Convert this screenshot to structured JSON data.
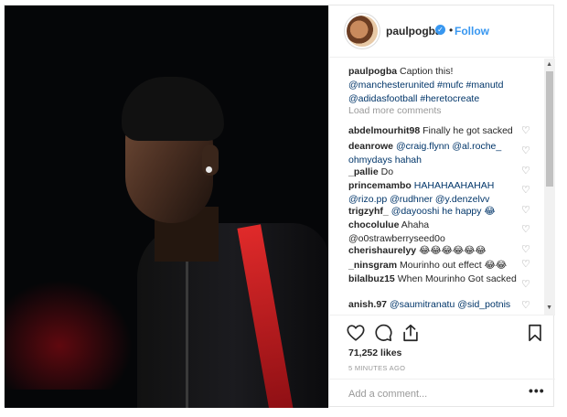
{
  "post": {
    "username": "paulpogba",
    "follow_label": "Follow",
    "dot": "•",
    "verified_glyph": "✓",
    "caption": {
      "username": "paulpogba",
      "line1_text": "Caption this!",
      "line2_tags": "@manchesterunited #mufc #manutd",
      "line3_tags": "@adidasfootball #heretocreate"
    },
    "load_more": "Load more comments",
    "comments": [
      {
        "user": "abdelmourhit98",
        "text": "Finally he got sacked"
      },
      {
        "user": "deanrowe",
        "text": "@craig.flynn @al.roche_ ohmydays hahah"
      },
      {
        "user": "_pallie",
        "text": "Do"
      },
      {
        "user": "princemambo",
        "text": "HAHAHAAHAHAH @rizo.pp @rudhner @y.denzelvv"
      },
      {
        "user": "trigzyhf_",
        "text": "@dayooshi he happy 😂"
      },
      {
        "user": "chocolulue",
        "text": "Ahaha @o0strawberryseed0o"
      },
      {
        "user": "cherishaurelyy",
        "text": "😂😂😂😂😂😂"
      },
      {
        "user": "_ninsgram",
        "text": "Mourinho out effect 😂😂"
      },
      {
        "user": "bilalbuz15",
        "text": "When Mourinho Got sacked"
      },
      {
        "user": "anish.97",
        "text": "@saumitranatu @sid_potnis"
      }
    ],
    "likes": "71,252 likes",
    "time": "5 MINUTES AGO",
    "add_comment_placeholder": "Add a comment...",
    "more_glyph": "•••",
    "heart_glyph": "♡",
    "scroll_up": "▲",
    "scroll_down": "▼"
  },
  "colors": {
    "link_blue": "#3897f0",
    "tag_blue": "#003569",
    "muted": "#999999",
    "text": "#262626"
  },
  "icons": [
    "heart-icon",
    "comment-icon",
    "share-icon",
    "bookmark-icon",
    "verified-icon",
    "more-options-icon"
  ]
}
